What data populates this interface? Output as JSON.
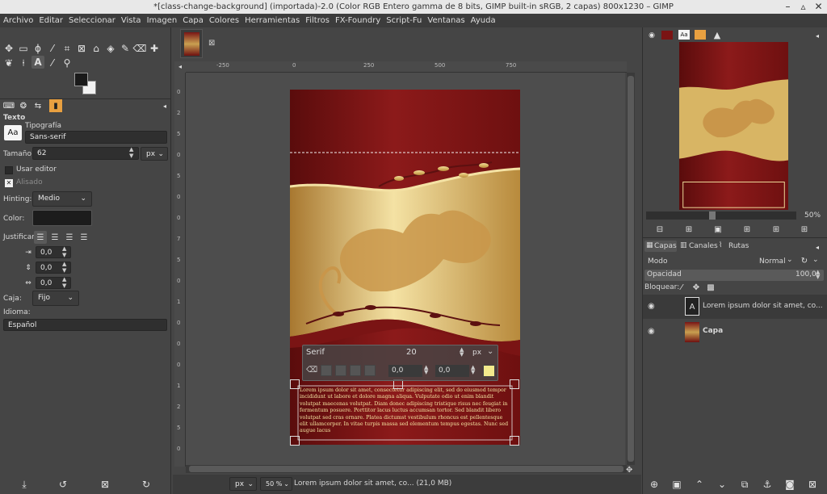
{
  "window": {
    "title": "*[class-change-background] (importada)-2.0 (Color RGB Entero gamma de 8 bits, GIMP built-in sRGB, 2 capas) 800x1230 – GIMP"
  },
  "menu": [
    "Archivo",
    "Editar",
    "Seleccionar",
    "Vista",
    "Imagen",
    "Capa",
    "Colores",
    "Herramientas",
    "Filtros",
    "FX-Foundry",
    "Script-Fu",
    "Ventanas",
    "Ayuda"
  ],
  "tool_options": {
    "title": "Texto",
    "font_label": "Tipografía",
    "font_value": "Sans-serif",
    "size_label": "Tamaño:",
    "size_value": "62",
    "size_unit": "px",
    "use_editor": "Usar editor",
    "antialias": "Alisado",
    "hinting_label": "Hinting:",
    "hinting_value": "Medio",
    "color_label": "Color:",
    "justify_label": "Justificar:",
    "indent": "0,0",
    "line_spacing": "0,0",
    "letter_spacing": "0,0",
    "box_label": "Caja:",
    "box_value": "Fijo",
    "lang_label": "Idioma:",
    "lang_value": "Español"
  },
  "ruler": {
    "top": [
      "-250",
      "0",
      "250",
      "500",
      "750"
    ],
    "left": [
      "0",
      "2",
      "5",
      "0",
      "5",
      "0",
      "0",
      "7",
      "5",
      "0",
      "1",
      "0",
      "0",
      "0",
      "1",
      "2",
      "5",
      "0"
    ]
  },
  "text_toolbar": {
    "font": "Serif",
    "size": "20",
    "unit": "px",
    "baseline": "0,0",
    "kerning": "0,0"
  },
  "image_text": "Lorem ipsum dolor sit amet, consectetur adipiscing elit, sed do eiusmod tempor incididunt ut labore et dolore magna aliqua. Vulputate odio ut enim blandit volutpat maecenas volutpat. Diam donec adipiscing tristique risus nec feugiat in fermentum posuere. Porttitor lacus luctus accumsan tortor. Sed blandit libero volutpat sed cras ornare. Platea dictumst vestibulum rhoncus est pellentesque elit ullamcorper. In vitae turpis massa sed elementum tempus egestas. Nunc sed augue lacus",
  "navigator": {
    "zoom": "50%"
  },
  "layers": {
    "tabs": [
      "Capas",
      "Canales",
      "Rutas"
    ],
    "mode_label": "Modo",
    "mode_value": "Normal",
    "opacity_label": "Opacidad",
    "opacity_value": "100,0",
    "lock_label": "Bloquear:",
    "items": [
      {
        "name": "Lorem ipsum dolor sit amet, co...",
        "type": "text"
      },
      {
        "name": "Capa",
        "type": "image"
      }
    ]
  },
  "status": {
    "unit": "px",
    "zoom": "50 %",
    "info": "Lorem ipsum dolor sit amet, co... (21,0 MB)"
  },
  "colors": {
    "accent": "#f4ea8c",
    "dark_red": "#6e1010",
    "gold": "#d9b860"
  }
}
